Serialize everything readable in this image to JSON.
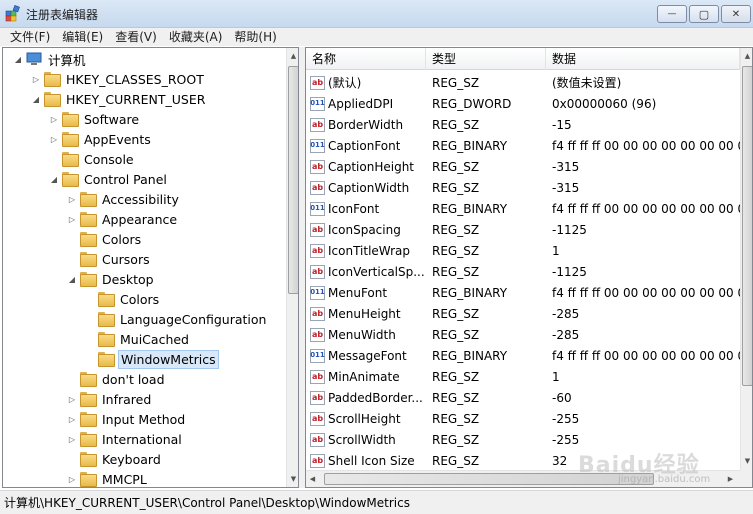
{
  "window": {
    "title": "注册表编辑器",
    "minimize_glyph": "—",
    "maximize_glyph": "▢",
    "close_glyph": "✕"
  },
  "menu": [
    "文件(F)",
    "编辑(E)",
    "查看(V)",
    "收藏夹(A)",
    "帮助(H)"
  ],
  "tree": [
    {
      "label": "计算机",
      "level": 0,
      "expander": "expanded",
      "icon": "computer-icon"
    },
    {
      "label": "HKEY_CLASSES_ROOT",
      "level": 1,
      "expander": "collapsed",
      "icon": "folder-icon"
    },
    {
      "label": "HKEY_CURRENT_USER",
      "level": 1,
      "expander": "expanded",
      "icon": "folder-icon"
    },
    {
      "label": "Software",
      "level": 2,
      "expander": "collapsed",
      "icon": "folder-icon"
    },
    {
      "label": "AppEvents",
      "level": 2,
      "expander": "collapsed",
      "icon": "folder-icon"
    },
    {
      "label": "Console",
      "level": 2,
      "expander": "none",
      "icon": "folder-icon"
    },
    {
      "label": "Control Panel",
      "level": 2,
      "expander": "expanded",
      "icon": "folder-icon"
    },
    {
      "label": "Accessibility",
      "level": 3,
      "expander": "collapsed",
      "icon": "folder-icon"
    },
    {
      "label": "Appearance",
      "level": 3,
      "expander": "collapsed",
      "icon": "folder-icon"
    },
    {
      "label": "Colors",
      "level": 3,
      "expander": "none",
      "icon": "folder-icon"
    },
    {
      "label": "Cursors",
      "level": 3,
      "expander": "none",
      "icon": "folder-icon"
    },
    {
      "label": "Desktop",
      "level": 3,
      "expander": "expanded",
      "icon": "folder-icon"
    },
    {
      "label": "Colors",
      "level": 4,
      "expander": "none",
      "icon": "folder-icon"
    },
    {
      "label": "LanguageConfiguration",
      "level": 4,
      "expander": "none",
      "icon": "folder-icon"
    },
    {
      "label": "MuiCached",
      "level": 4,
      "expander": "none",
      "icon": "folder-icon"
    },
    {
      "label": "WindowMetrics",
      "level": 4,
      "expander": "none",
      "icon": "folder-icon",
      "selected": true
    },
    {
      "label": "don't load",
      "level": 3,
      "expander": "none",
      "icon": "folder-icon"
    },
    {
      "label": "Infrared",
      "level": 3,
      "expander": "collapsed",
      "icon": "folder-icon"
    },
    {
      "label": "Input Method",
      "level": 3,
      "expander": "collapsed",
      "icon": "folder-icon"
    },
    {
      "label": "International",
      "level": 3,
      "expander": "collapsed",
      "icon": "folder-icon"
    },
    {
      "label": "Keyboard",
      "level": 3,
      "expander": "none",
      "icon": "folder-icon"
    },
    {
      "label": "MMCPL",
      "level": 3,
      "expander": "collapsed",
      "icon": "folder-icon"
    }
  ],
  "list": {
    "headers": [
      "名称",
      "类型",
      "数据"
    ],
    "rows": [
      {
        "name": "(默认)",
        "type": "REG_SZ",
        "data": "(数值未设置)",
        "icon": "sz"
      },
      {
        "name": "AppliedDPI",
        "type": "REG_DWORD",
        "data": "0x00000060 (96)",
        "icon": "bin"
      },
      {
        "name": "BorderWidth",
        "type": "REG_SZ",
        "data": "-15",
        "icon": "sz"
      },
      {
        "name": "CaptionFont",
        "type": "REG_BINARY",
        "data": "f4 ff ff ff 00 00 00 00 00 00 00 0",
        "icon": "bin"
      },
      {
        "name": "CaptionHeight",
        "type": "REG_SZ",
        "data": "-315",
        "icon": "sz"
      },
      {
        "name": "CaptionWidth",
        "type": "REG_SZ",
        "data": "-315",
        "icon": "sz"
      },
      {
        "name": "IconFont",
        "type": "REG_BINARY",
        "data": "f4 ff ff ff 00 00 00 00 00 00 00 0",
        "icon": "bin"
      },
      {
        "name": "IconSpacing",
        "type": "REG_SZ",
        "data": "-1125",
        "icon": "sz"
      },
      {
        "name": "IconTitleWrap",
        "type": "REG_SZ",
        "data": "1",
        "icon": "sz"
      },
      {
        "name": "IconVerticalSp...",
        "type": "REG_SZ",
        "data": "-1125",
        "icon": "sz"
      },
      {
        "name": "MenuFont",
        "type": "REG_BINARY",
        "data": "f4 ff ff ff 00 00 00 00 00 00 00 0",
        "icon": "bin"
      },
      {
        "name": "MenuHeight",
        "type": "REG_SZ",
        "data": "-285",
        "icon": "sz"
      },
      {
        "name": "MenuWidth",
        "type": "REG_SZ",
        "data": "-285",
        "icon": "sz"
      },
      {
        "name": "MessageFont",
        "type": "REG_BINARY",
        "data": "f4 ff ff ff 00 00 00 00 00 00 00 0",
        "icon": "bin"
      },
      {
        "name": "MinAnimate",
        "type": "REG_SZ",
        "data": "1",
        "icon": "sz"
      },
      {
        "name": "PaddedBorder...",
        "type": "REG_SZ",
        "data": "-60",
        "icon": "sz"
      },
      {
        "name": "ScrollHeight",
        "type": "REG_SZ",
        "data": "-255",
        "icon": "sz"
      },
      {
        "name": "ScrollWidth",
        "type": "REG_SZ",
        "data": "-255",
        "icon": "sz"
      },
      {
        "name": "Shell Icon Size",
        "type": "REG_SZ",
        "data": "32",
        "icon": "sz"
      }
    ]
  },
  "icons": {
    "sz": "ab",
    "bin": "011"
  },
  "status": "计算机\\HKEY_CURRENT_USER\\Control Panel\\Desktop\\WindowMetrics",
  "watermark": {
    "brand": "Baidu经验",
    "url": "jingyan.baidu.com"
  },
  "colors": {
    "selection": "#d9e8f9",
    "titlebar": "#c6d9ee"
  }
}
